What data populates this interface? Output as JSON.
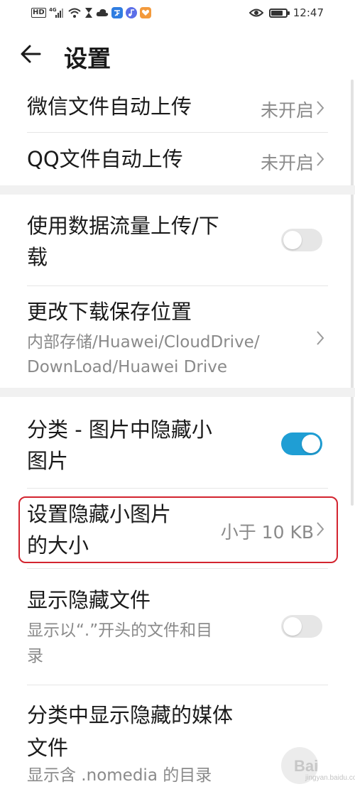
{
  "status_bar": {
    "hd": "HD",
    "network": "4G",
    "time": "12:47"
  },
  "header": {
    "title": "设置"
  },
  "settings": {
    "wechat_upload": {
      "title": "微信文件自动上传",
      "value": "未开启"
    },
    "qq_upload": {
      "title": "QQ文件自动上传",
      "value": "未开启"
    },
    "mobile_data": {
      "title_line1": "使用数据流量上传/下",
      "title_line2": "载",
      "enabled": false
    },
    "download_location": {
      "title": "更改下载保存位置",
      "path_line1": "内部存储/Huawei/CloudDrive/",
      "path_line2": "DownLoad/Huawei Drive"
    },
    "hide_small_images": {
      "title_line1": "分类 - 图片中隐藏小",
      "title_line2": "图片",
      "enabled": true
    },
    "small_image_size": {
      "title_line1": "设置隐藏小图片",
      "title_line2": "的大小",
      "value": "小于 10 KB"
    },
    "show_hidden_files": {
      "title": "显示隐藏文件",
      "sub_line1": "显示以“.”开头的文件和目",
      "sub_line2": "录",
      "enabled": false
    },
    "show_hidden_media": {
      "title_line1": "分类中显示隐藏的媒体",
      "title_line2": "文件",
      "sub": "显示含 .nomedia 的目录"
    }
  },
  "watermark": {
    "text": "Bai",
    "sub": "jingyan.baidu.com"
  },
  "colors": {
    "accent": "#1f9ed4",
    "highlight": "#d3242f",
    "text_primary": "#1a1a1a",
    "text_secondary": "#8a8a8a"
  }
}
